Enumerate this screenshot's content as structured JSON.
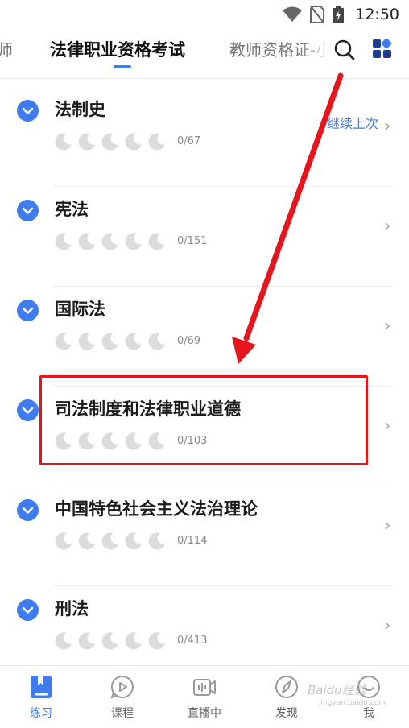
{
  "status_bar": {
    "time": "12:50"
  },
  "tabs": [
    {
      "label": "师"
    },
    {
      "label": "法律职业资格考试"
    },
    {
      "label": "教师资格证-小"
    }
  ],
  "continue_link": "继续上次",
  "chapters": [
    {
      "title": "法制史",
      "progress": "0/67"
    },
    {
      "title": "宪法",
      "progress": "0/151"
    },
    {
      "title": "国际法",
      "progress": "0/69"
    },
    {
      "title": "司法制度和法律职业道德",
      "progress": "0/103"
    },
    {
      "title": "中国特色社会主义法治理论",
      "progress": "0/114"
    },
    {
      "title": "刑法",
      "progress": "0/413"
    }
  ],
  "bottom_nav": [
    {
      "label": "练习"
    },
    {
      "label": "课程"
    },
    {
      "label": "直播中"
    },
    {
      "label": "发现"
    },
    {
      "label": "我"
    }
  ],
  "watermark": {
    "brand": "Baidu经验",
    "url": "jingyan.baidu.com"
  },
  "colors": {
    "accent": "#3f7cf2",
    "annotation": "#e8141c",
    "icon_inactive": "#dcdcdc"
  }
}
